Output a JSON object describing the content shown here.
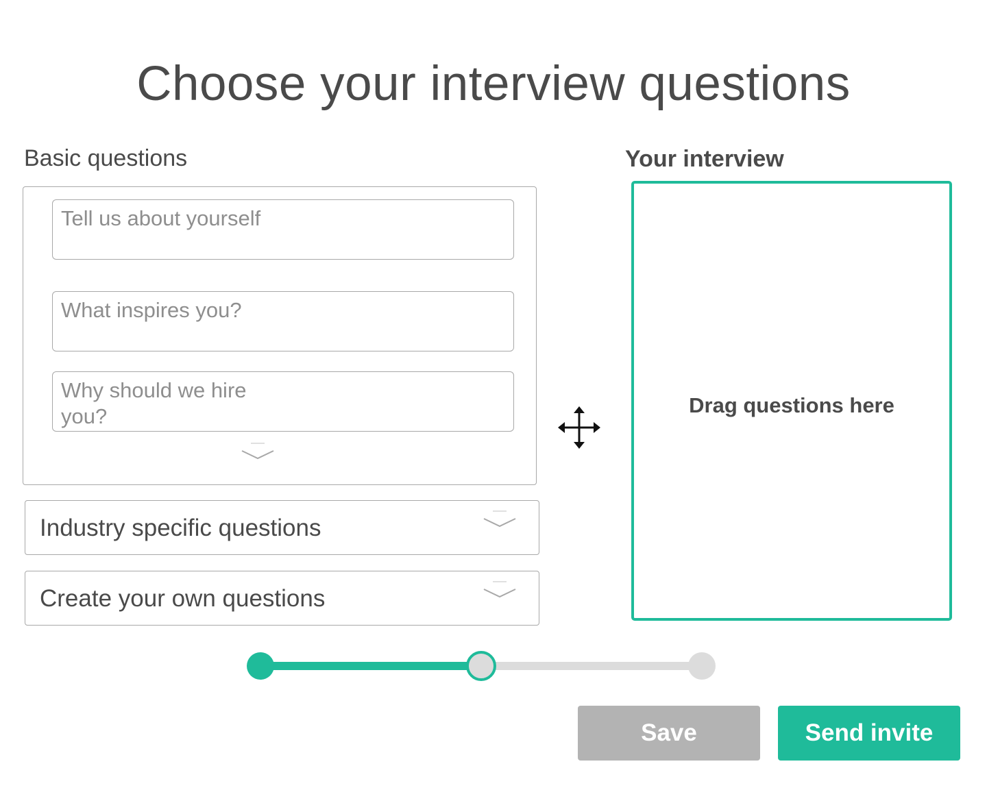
{
  "page": {
    "title": "Choose your interview questions"
  },
  "basic": {
    "heading": "Basic questions",
    "questions": [
      "Tell us about yourself",
      "What inspires you?",
      "Why should we hire you?"
    ],
    "expand_icon": "chevron-down-icon"
  },
  "sections": [
    {
      "label": "Industry specific questions",
      "icon": "chevron-down-icon"
    },
    {
      "label": "Create your own questions",
      "icon": "chevron-down-icon"
    }
  ],
  "interview": {
    "heading": "Your interview",
    "dropzone_text": "Drag questions here",
    "drag_icon": "move-arrows-icon"
  },
  "progress": {
    "total_steps": 3,
    "current_step": 2,
    "completed_steps": 1
  },
  "actions": {
    "save_label": "Save",
    "send_label": "Send invite"
  },
  "colors": {
    "accent": "#1fbb9a",
    "text": "#4a4a4a",
    "muted_text": "#8e8e8e",
    "border": "#a8a8a8",
    "disabled_button": "#b3b3b3",
    "track_inactive": "#dcdcdc"
  }
}
